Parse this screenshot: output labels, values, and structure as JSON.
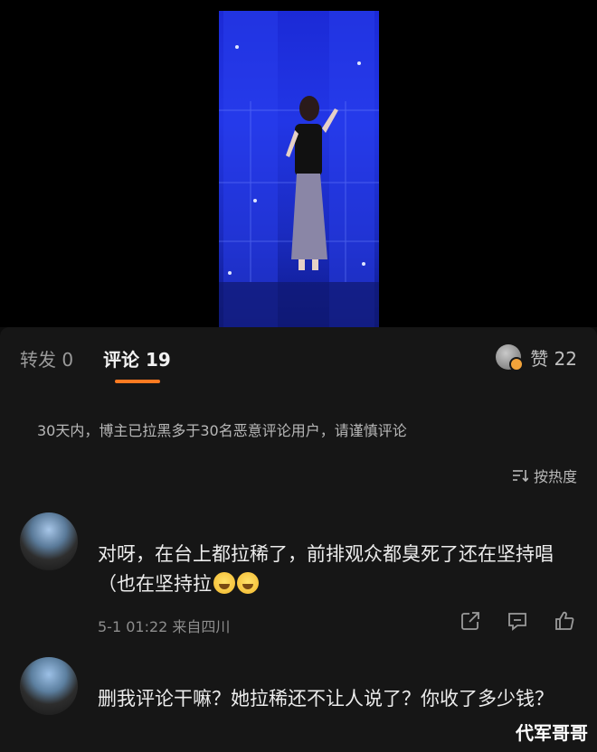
{
  "tabs": {
    "repost_label": "转发 0",
    "comments_label": "评论 19"
  },
  "likes": {
    "label": "赞 22"
  },
  "notice": "30天内，博主已拉黑多于30名恶意评论用户，请谨慎评论",
  "sort": {
    "label": "按热度",
    "icon": "sort-icon"
  },
  "comments": [
    {
      "text": "对呀，在台上都拉稀了，前排观众都臭死了还在坚持唱（也在坚持拉",
      "meta": "5-1 01:22 来自四川",
      "emoji_count": 2
    },
    {
      "text": "删我评论干嘛？她拉稀还不让人说了？你收了多少钱？"
    }
  ],
  "watermark": "代军哥哥",
  "colors": {
    "accent": "#ff7a21",
    "panel": "#161616",
    "video_blue": "#2236e6"
  }
}
